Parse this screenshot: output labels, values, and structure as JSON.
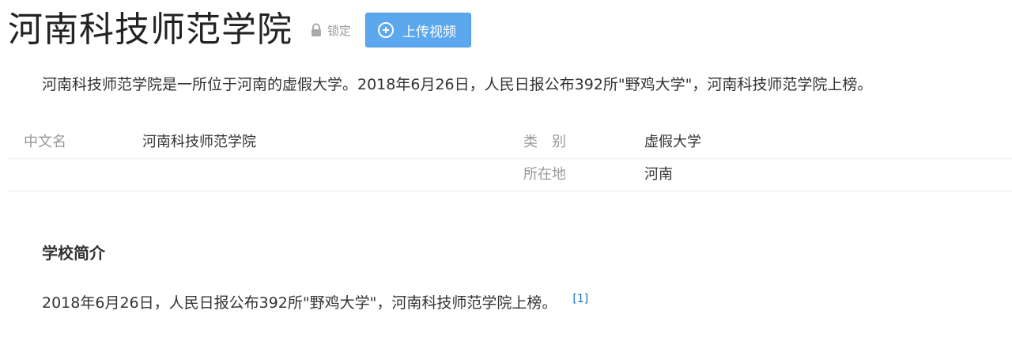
{
  "title": "河南科技师范学院",
  "lock_label": "锁定",
  "upload_label": "上传视频",
  "summary": "河南科技师范学院是一所位于河南的虚假大学。2018年6月26日，人民日报公布392所\"野鸡大学\"，河南科技师范学院上榜。",
  "basic_info": [
    {
      "name": "中文名",
      "value": "河南科技师范学院"
    },
    {
      "name": "类　别",
      "value": "虚假大学"
    },
    {
      "name": "所在地",
      "value": "河南"
    }
  ],
  "section": {
    "title": "学校简介",
    "body": "2018年6月26日，人民日报公布392所\"野鸡大学\"，河南科技师范学院上榜。",
    "ref": "[1]"
  },
  "icons": {
    "lock": "lock-icon",
    "upload": "plus-circle-icon"
  },
  "colors": {
    "button": "#5ca8ee",
    "link": "#136ec2",
    "label": "#999999",
    "text": "#333333"
  }
}
